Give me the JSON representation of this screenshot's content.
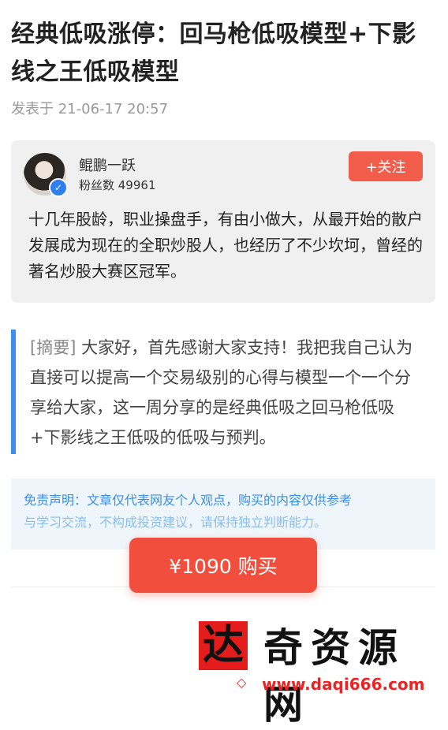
{
  "article": {
    "title": "经典低吸涨停：回马枪低吸模型+下影线之王低吸模型",
    "published": "发表于 21-06-17 20:57"
  },
  "author": {
    "name": "鲲鹏一跃",
    "fans": "粉丝数 49961",
    "follow_label": "+关注",
    "bio": "十几年股龄，职业操盘手，有由小做大，从最开始的散户发展成为现在的全职炒股人，也经历了不少坎坷，曾经的著名炒股大赛区冠军。",
    "verified_icon": "verified-check-icon"
  },
  "summary": {
    "tag": "[摘要]",
    "text": " 大家好，首先感谢大家支持！我把我自己认为直接可以提高一个交易级别的心得与模型一个一个分享给大家，这一周分享的是经典低吸之回马枪低吸+下影线之王低吸的低吸与预判。"
  },
  "disclaimer": {
    "line1": "免责声明：文章仅代表网友个人观点，购买的内容仅供参考",
    "line2": "与学习交流，不构成投资建议，请保持独立判断能力。"
  },
  "purchase": {
    "label": "¥1090 购买"
  },
  "watermark": {
    "logo_char": "达",
    "name": "奇资源网",
    "url": "www.daqi666.com"
  },
  "colors": {
    "accent_red": "#f24e3e",
    "accent_blue": "#3d8ef0",
    "card_bg": "#f0f0f0"
  }
}
